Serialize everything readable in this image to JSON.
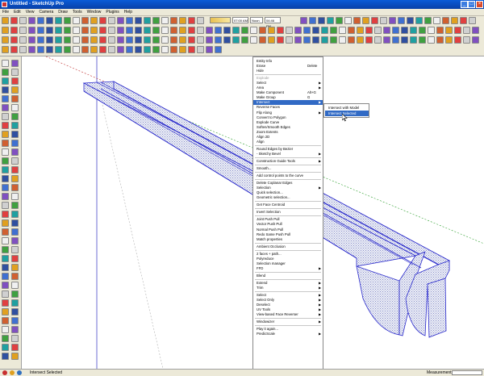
{
  "window": {
    "title": "Untitled - SketchUp Pro"
  },
  "menubar": [
    "File",
    "Edit",
    "View",
    "Camera",
    "Draw",
    "Tools",
    "Window",
    "Plugins",
    "Help"
  ],
  "toolbar_fields": {
    "time": "07:00 AM",
    "noon": "Noon",
    "pm": "04:46 PM"
  },
  "context_menu": [
    {
      "label": "Entity Info"
    },
    {
      "label": "Erase",
      "shortcut": "Delete"
    },
    {
      "label": "Hide"
    },
    {
      "sep": true
    },
    {
      "label": "Explode",
      "disabled": true
    },
    {
      "label": "Select",
      "arrow": true
    },
    {
      "label": "Area",
      "arrow": true
    },
    {
      "label": "Make Component",
      "shortcut": "Alt+G"
    },
    {
      "label": "Make Group",
      "shortcut": "G"
    },
    {
      "label": "Intersect",
      "arrow": true,
      "highlighted": true
    },
    {
      "label": "Reverse Faces"
    },
    {
      "label": "Flip Along",
      "arrow": true
    },
    {
      "label": "Convert to Polygon"
    },
    {
      "label": "Explode Curve"
    },
    {
      "label": "Soften/Smooth Edges"
    },
    {
      "label": "Zoom Extents"
    },
    {
      "label": "Align 2D"
    },
    {
      "label": "Align"
    },
    {
      "sep": true
    },
    {
      "label": "Round Edges by Bezier"
    },
    {
      "label": "- Sketchy Bevel",
      "arrow": true
    },
    {
      "sep": true
    },
    {
      "label": "Construction Guide Tools",
      "arrow": true
    },
    {
      "sep": true
    },
    {
      "label": "Smooth..."
    },
    {
      "sep": true
    },
    {
      "label": "Add control points to the curve"
    },
    {
      "sep": true
    },
    {
      "label": "Delete Coplanar Edges"
    },
    {
      "label": "Selection",
      "arrow": true
    },
    {
      "label": "Quick selection..."
    },
    {
      "label": "Geometric selection..."
    },
    {
      "sep": true
    },
    {
      "label": "Get Face Centroid"
    },
    {
      "sep": true
    },
    {
      "label": "Invert Selection"
    },
    {
      "sep": true
    },
    {
      "label": "Joint Push Pull"
    },
    {
      "label": "Vector Push Pull"
    },
    {
      "label": "Normal Push Pull"
    },
    {
      "label": "Redo Same Push Pull"
    },
    {
      "label": "Match properties"
    },
    {
      "sep": true
    },
    {
      "label": "Ambient Occlusion"
    },
    {
      "sep": true
    },
    {
      "label": "2 faces + path..."
    },
    {
      "label": "Polyreduce"
    },
    {
      "label": "Selection manager"
    },
    {
      "label": "FFD",
      "arrow": true
    },
    {
      "sep": true
    },
    {
      "label": "Blend"
    },
    {
      "sep": true
    },
    {
      "label": "Extend",
      "arrow": true
    },
    {
      "label": "Trim",
      "arrow": true
    },
    {
      "sep": true
    },
    {
      "label": "Select",
      "arrow": true
    },
    {
      "label": "Select Only",
      "arrow": true
    },
    {
      "label": "Deselect",
      "arrow": true
    },
    {
      "label": "UV Tools",
      "arrow": true
    },
    {
      "label": "View-based Face Reverser",
      "arrow": true
    },
    {
      "sep": true
    },
    {
      "label": "Windowizer",
      "arrow": true
    },
    {
      "sep": true
    },
    {
      "label": "Play it again..."
    },
    {
      "label": "PredicScale",
      "arrow": true
    }
  ],
  "submenu": [
    {
      "label": "Intersect with Model"
    },
    {
      "label": "Intersect Selected",
      "highlighted": true
    }
  ],
  "statusbar": {
    "text": "Intersect Selected",
    "measurements_label": "Measurements"
  }
}
